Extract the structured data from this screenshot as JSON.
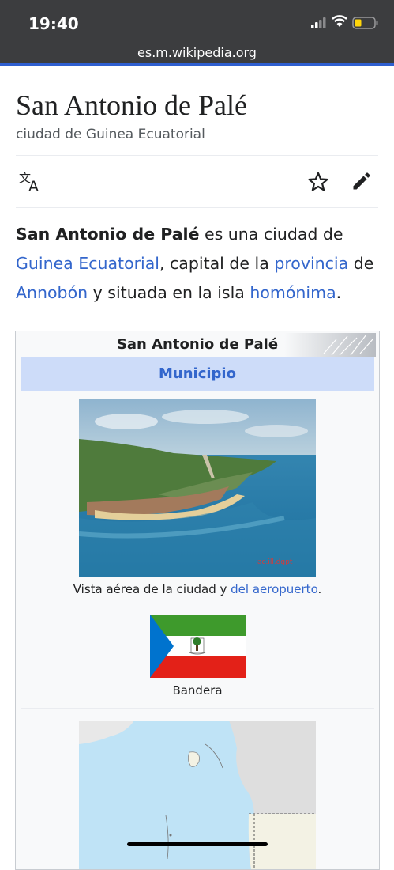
{
  "status": {
    "time": "19:40",
    "url": "es.m.wikipedia.org"
  },
  "article": {
    "title": "San Antonio de Palé",
    "subtitle": "ciudad de Guinea Ecuatorial",
    "lead": {
      "bold": "San Antonio de Palé",
      "t1": " es una ciudad de ",
      "link1": "Guinea Ecuatorial",
      "t2": ", capital de la ",
      "link2": "provincia",
      "t3": " de ",
      "link3": "Annobón",
      "t4": " y situada en la isla ",
      "link4": "homónima",
      "t5": "."
    }
  },
  "infobox": {
    "name": "San Antonio de Palé",
    "type": "Municipio",
    "photo_caption_text": "Vista aérea de la ciudad y ",
    "photo_caption_link": "del aeropuerto",
    "photo_caption_end": ".",
    "flag_caption": "Bandera"
  },
  "icons": [
    "translate-icon",
    "star-icon",
    "edit-pencil-icon",
    "signal-icon",
    "wifi-icon",
    "battery-icon"
  ],
  "colors": {
    "link": "#3366cc",
    "header_band": "#cddcf9",
    "status_bg": "#3c3d3f"
  }
}
